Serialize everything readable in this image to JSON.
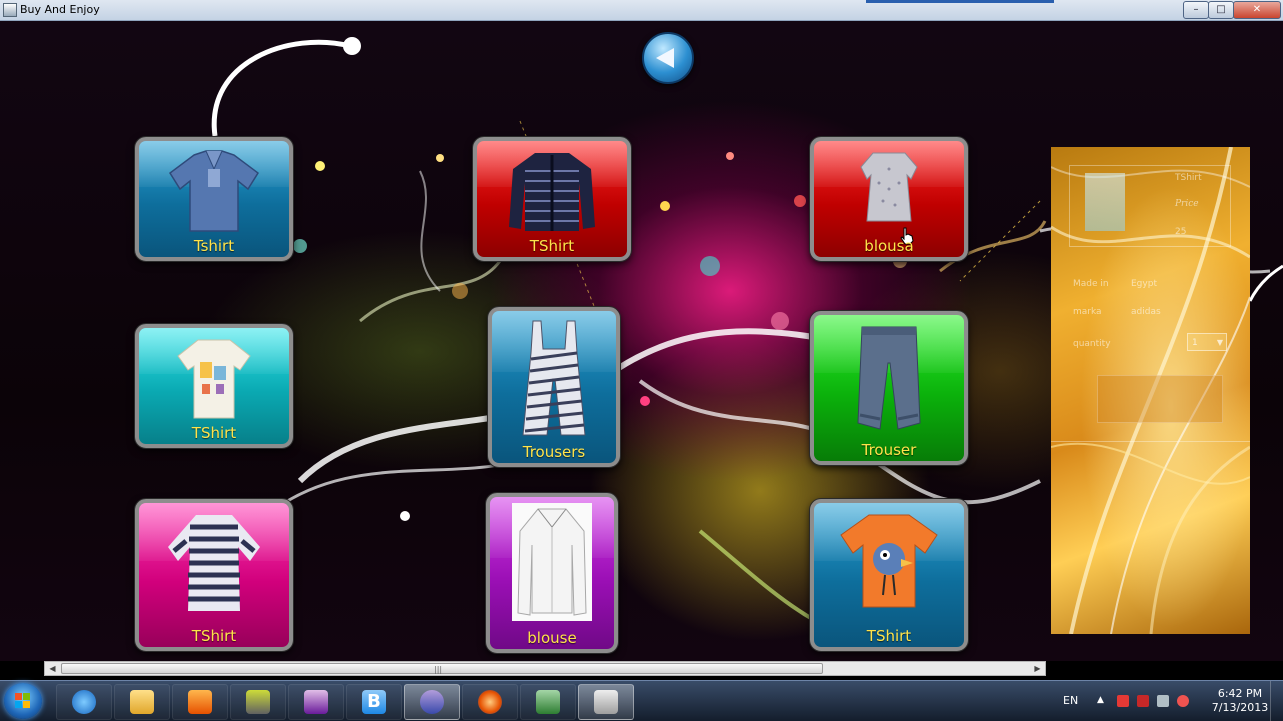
{
  "window": {
    "title": "Buy And Enjoy",
    "min_label": "–",
    "max_label": "□",
    "close_label": "✕"
  },
  "products": [
    {
      "label": "Tshirt",
      "color": "blue",
      "icon": "polo-shirt-icon"
    },
    {
      "label": "TShirt",
      "color": "red",
      "icon": "striped-cardigan-icon"
    },
    {
      "label": "blousa",
      "color": "red",
      "icon": "blouse-icon"
    },
    {
      "label": "TShirt",
      "color": "cyan",
      "icon": "kids-tshirt-icon"
    },
    {
      "label": "Trousers",
      "color": "blue",
      "icon": "striped-overalls-icon"
    },
    {
      "label": "Trouser",
      "color": "green",
      "icon": "trousers-icon"
    },
    {
      "label": "TShirt",
      "color": "pink",
      "icon": "striped-longsleeve-icon"
    },
    {
      "label": "blouse",
      "color": "purple",
      "icon": "white-shirt-icon"
    },
    {
      "label": "TShirt",
      "color": "blue",
      "icon": "orange-tshirt-icon"
    }
  ],
  "details": {
    "name": "TShirt",
    "price_label": "Price",
    "price": "25",
    "made_in_label": "Made in",
    "made_in": "Egypt",
    "marka_label": "marka",
    "marka": "adidas",
    "quantity_label": "quantity",
    "quantity": "1"
  },
  "taskbar": {
    "lang": "EN",
    "time": "6:42 PM",
    "date": "7/13/2013",
    "apps": [
      "internet-explorer-icon",
      "folder-icon",
      "media-player-icon",
      "tools-icon",
      "visual-studio-icon",
      "b-app-icon",
      "infinity-app-icon",
      "firefox-icon",
      "network-app-icon",
      "shopping-cart-app-icon"
    ]
  },
  "scrollbar": {
    "grip": "|||"
  }
}
